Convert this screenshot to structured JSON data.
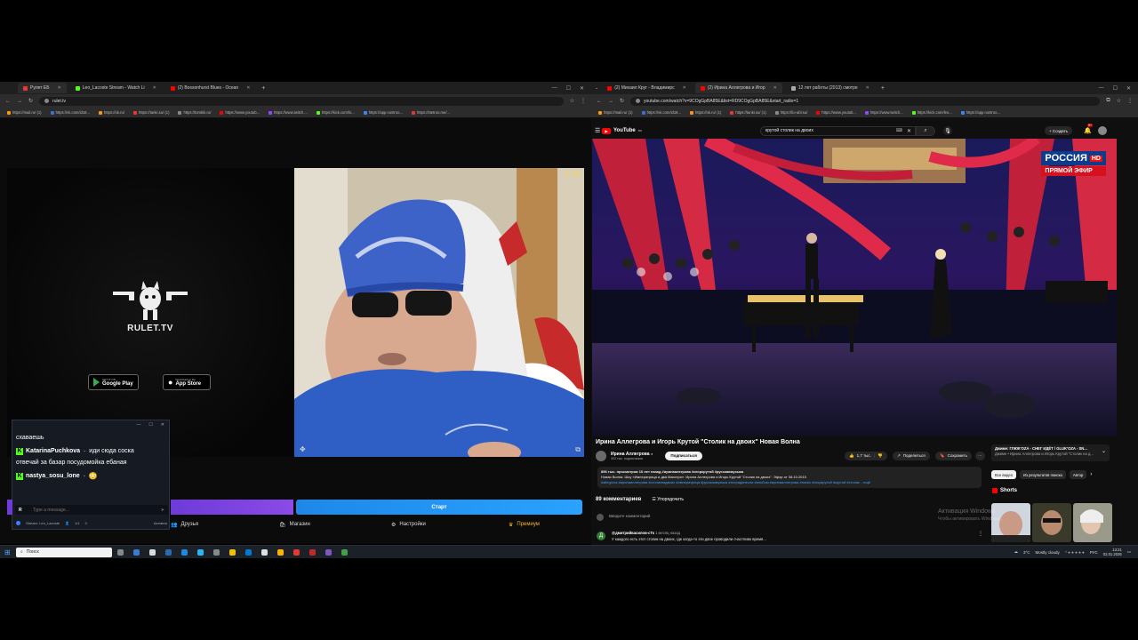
{
  "left_browser": {
    "tabs": [
      {
        "label": "Рулет ЕБ",
        "color": "#e33"
      },
      {
        "label": "Leo_Lacoste Stream - Watch Li",
        "color": "#53fc18"
      },
      {
        "label": "(2) Bossonhurst Blues - Ocean",
        "color": "#f00"
      }
    ],
    "new_tab": "+",
    "url": "rulet.tv",
    "bookmarks": [
      "https://mail.ru/ (1)",
      "https://vk.com/id18...",
      "https://ok.ru/",
      "https://tanki.su/ (1)",
      "https://tombik.ru/",
      "https://www.youtub...",
      "https://www.twitch....",
      "https://kick.com/lo...",
      "https://app.nostroo...",
      "https://stetroo.me/..."
    ]
  },
  "rulet": {
    "brand": "RULET.TV",
    "google_play_top": "GET IT ON",
    "google_play": "Google Play",
    "app_store_top": "Download on the",
    "app_store": "App Store",
    "start_button": "Старт",
    "nav": [
      {
        "label": "Друзья",
        "icon": "people-icon"
      },
      {
        "label": "Магазин",
        "icon": "bag-icon"
      },
      {
        "label": "Настройки",
        "icon": "gear-icon"
      },
      {
        "label": "Премиум",
        "icon": "crown-icon"
      }
    ],
    "rating": "25"
  },
  "chat": {
    "messages": [
      {
        "user": "",
        "text": "схаваешь"
      },
      {
        "user": "KatarinaPuchkova",
        "text": "иди сюда соска"
      },
      {
        "user": "",
        "text": "отвечай за базар посудомойка ебаная"
      },
      {
        "user": "nastya_sosu_lone",
        "text": ""
      }
    ],
    "input_placeholder": "Type a message...",
    "footer_stream": "Stream: Leo_Lacoste",
    "footer_count": "1/1",
    "footer_count2": "0",
    "footer_right": "Активно"
  },
  "right_browser": {
    "tabs": [
      {
        "label": "(2) Михаил Круг - Владимирс",
        "color": "#f00"
      },
      {
        "label": "(2) Ирина Аллегрова и Игор",
        "color": "#f00"
      },
      {
        "label": "12 лет работы (2013) смотре",
        "color": "#aaa"
      }
    ],
    "url": "youtube.com/watch?v=9COgGpBA85E&list=RD9COgGpBA85E&start_radio=1",
    "bookmarks": [
      "https://mail.ru/ (1)",
      "https://vk.com/id18...",
      "https://ok.ru/ (1)",
      "https://tanki.su/ (1)",
      "https://lio-abl.su/",
      "https://www.youtub...",
      "https://www.twitch...",
      "https://kick.com/leo...",
      "https://app.nostroo..."
    ]
  },
  "youtube": {
    "logo": "YouTube",
    "logo_suffix": "RU",
    "search_value": "крутой столик на двоих",
    "create": "Создать",
    "notif_count": "9+",
    "video_bug_channel": "РОССИЯ",
    "video_bug_hd": "HD",
    "video_bug_live": "ПРЯМОЙ ЭФИР",
    "title": "Ирина Аллегрова и Игорь Крутой \"Столик на двоих\" Новая Волна",
    "channel": "Ирина Аллегрова",
    "subs": "303 тыс. подписчиков",
    "subscribe": "Подписаться",
    "likes": "1,7 тыс.",
    "share": "Поделиться",
    "save": "Сохранить",
    "desc_line1": "896 тыс. просмотров  10 лет назад  #иринаалегрова #игоркрутой #русскаямузыка",
    "desc_line2": "Новая Волна. Шоу «Императрица и два Маэстро». Ирина Аллегрова и Игорь Крутой \"Столик на двоих\". Эфир от 08.10.2015",
    "desc_tags": "#allegrova #иринааллегрова #столикнадвоих #императрица #русскаямузыка #эстрадапесни #альбом #иринааллегрова #music #игоркрутой #крутой #столик ...ещё",
    "comments_title": "89 комментариев",
    "sort": "Упорядочить",
    "add_comment": "Введите комментарий",
    "comment_user": "@дмитрийвасилов-сТк",
    "comment_age": "1 месяц назад",
    "comment_text": "У каждого есть этот столик на двоих, где когда-то эти двое проводили счастливо время...",
    "side_card_title": "Джиме: ГЛЮК'OZA - СНЕГ ИДЁТ / GLUK'OZA - SN...",
    "side_card_sub": "Джиме • Ирина Аллегрова и Игорь Крутой \"Столик на д...",
    "chips": [
      "Все видео",
      "Из результатов поиска",
      "Автор"
    ],
    "shorts": "Shorts"
  },
  "watermark": {
    "line1": "Активация Windows",
    "line2": "Чтобы активировать Windows..."
  },
  "taskbar": {
    "search": "Поиск",
    "weather": "3°C",
    "weather_desc": "Mostly cloudy",
    "lang": "РУС",
    "time": "13:21",
    "date": "02.01.2026"
  }
}
